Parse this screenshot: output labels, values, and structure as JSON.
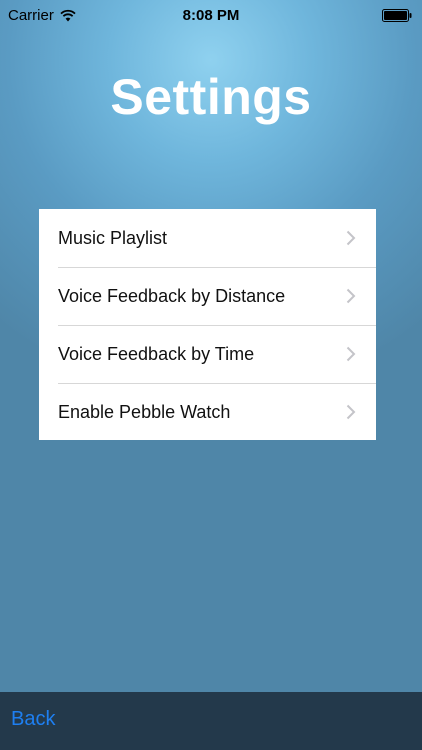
{
  "status_bar": {
    "carrier": "Carrier",
    "time": "8:08 PM",
    "wifi_icon": "wifi-icon",
    "battery_icon": "battery-icon"
  },
  "title": "Settings",
  "settings": {
    "items": [
      {
        "label": "Music Playlist",
        "icon": "chevron-right-icon"
      },
      {
        "label": "Voice Feedback by Distance",
        "icon": "chevron-right-icon"
      },
      {
        "label": "Voice Feedback by Time",
        "icon": "chevron-right-icon"
      },
      {
        "label": "Enable Pebble Watch",
        "icon": "chevron-right-icon"
      }
    ]
  },
  "toolbar": {
    "back_label": "Back"
  },
  "colors": {
    "accent": "#1e7ff1",
    "toolbar_bg": "#23394b",
    "title_text": "#ffffff"
  }
}
